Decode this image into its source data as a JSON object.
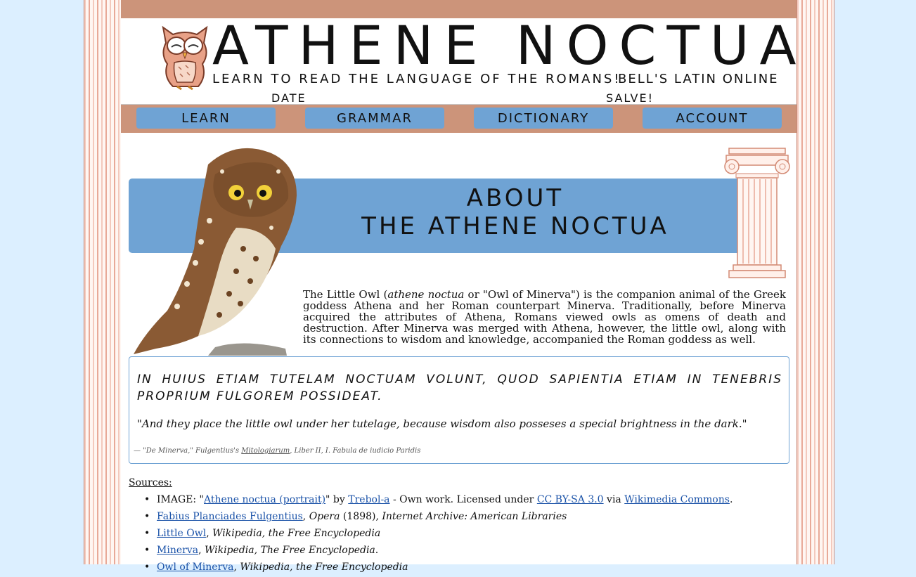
{
  "header": {
    "title": "ATHENE NOCTUA",
    "tagline": "LEARN TO READ THE LANGUAGE OF THE ROMANS!",
    "subtitle": "BELL'S LATIN ONLINE",
    "date_label": "DATE",
    "salve_label": "SALVE!"
  },
  "nav": {
    "learn": "LEARN",
    "grammar": "GRAMMAR",
    "dictionary": "DICTIONARY",
    "account": "ACCOUNT"
  },
  "about": {
    "line1": "ABOUT",
    "line2": "THE ATHENE NOCTUA"
  },
  "intro": {
    "pre": "The Little Owl (",
    "latin_name": "athene noctua",
    "post": " or \"Owl of Minerva\") is the companion animal of the Greek goddess Athena and her Roman counterpart Minerva. Traditionally, before Minerva acquired the attributes of Athena, Romans viewed owls as omens of death and destruction. After Minerva was merged with Athena, however, the little owl, along with its connections to wisdom and knowledge, accompanied the Roman goddess as well."
  },
  "quote": {
    "latin": "In huius etiam tutelam noctuam volunt, quod sapientia etiam in tenebris proprium fulgorem possideat.",
    "translation": "\"And they place the little owl under her tutelage, because wisdom also posseses a special brightness in the dark.\"",
    "citation_pre": "— \"De Minerva,\" Fulgentius's ",
    "citation_link": "Mitologiarum",
    "citation_post": ", Liber II, I. Fabula de iudicio Paridis"
  },
  "sources": {
    "label": "Sources:",
    "s1": {
      "pre": "IMAGE: \"",
      "link1": "Athene noctua (portrait)",
      "mid1": "\" by ",
      "link2": "Trebol-a",
      "mid2": " - Own work. Licensed under ",
      "link3": "CC BY-SA 3.0",
      "mid3": " via ",
      "link4": "Wikimedia Commons",
      "end": "."
    },
    "s2": {
      "link": "Fabius Planciades Fulgentius",
      "sep": ", ",
      "work": "Opera",
      "year": " (1898), ",
      "publisher": "Internet Archive: American Libraries"
    },
    "s3": {
      "link": "Little Owl",
      "sep": ", ",
      "site": "Wikipedia, the Free Encyclopedia"
    },
    "s4": {
      "link": "Minerva",
      "sep": ", ",
      "site": "Wikipedia, The Free Encyclopedia",
      "end": "."
    },
    "s5": {
      "link": "Owl of Minerva",
      "sep": ", ",
      "site": "Wikipedia, the Free Encyclopedia"
    }
  },
  "colors": {
    "accent_blue": "#6fa3d4",
    "terracotta": "#cc947a",
    "pillar_pink": "#f3c9bd"
  }
}
